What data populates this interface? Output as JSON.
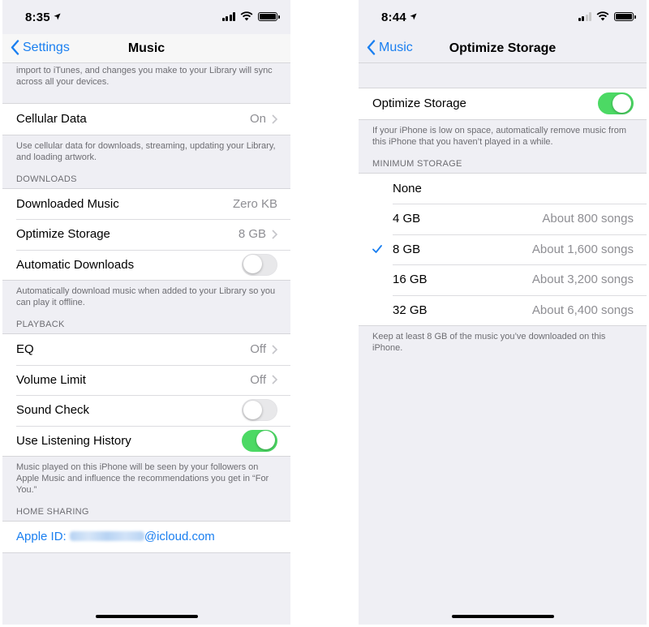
{
  "left": {
    "status": {
      "time": "8:35"
    },
    "nav": {
      "back_label": "Settings",
      "title": "Music"
    },
    "top_footer": "import to iTunes, and changes you make to your Library will sync across all your devices.",
    "cellular": {
      "label": "Cellular Data",
      "value": "On",
      "footer": "Use cellular data for downloads, streaming, updating your Library, and loading artwork."
    },
    "downloads": {
      "header": "DOWNLOADS",
      "downloaded_music": {
        "label": "Downloaded Music",
        "value": "Zero KB"
      },
      "optimize_storage": {
        "label": "Optimize Storage",
        "value": "8 GB"
      },
      "automatic_downloads": {
        "label": "Automatic Downloads",
        "on": false
      },
      "footer": "Automatically download music when added to your Library so you can play it offline."
    },
    "playback": {
      "header": "PLAYBACK",
      "eq": {
        "label": "EQ",
        "value": "Off"
      },
      "volume_limit": {
        "label": "Volume Limit",
        "value": "Off"
      },
      "sound_check": {
        "label": "Sound Check",
        "on": false
      },
      "listening_history": {
        "label": "Use Listening History",
        "on": true
      },
      "footer": "Music played on this iPhone will be seen by your followers on Apple Music and influence the recommendations you get in “For You.”"
    },
    "home_sharing": {
      "header": "HOME SHARING",
      "apple_id_prefix": "Apple ID: ",
      "apple_id_domain": "@icloud.com"
    }
  },
  "right": {
    "status": {
      "time": "8:44"
    },
    "nav": {
      "back_label": "Music",
      "title": "Optimize Storage"
    },
    "optimize": {
      "label": "Optimize Storage",
      "on": true,
      "footer": "If your iPhone is low on space, automatically remove music from this iPhone that you haven’t played in a while."
    },
    "minimum_storage": {
      "header": "MINIMUM STORAGE",
      "options": [
        {
          "label": "None",
          "detail": "",
          "selected": false
        },
        {
          "label": "4 GB",
          "detail": "About 800 songs",
          "selected": false
        },
        {
          "label": "8 GB",
          "detail": "About 1,600 songs",
          "selected": true
        },
        {
          "label": "16 GB",
          "detail": "About 3,200 songs",
          "selected": false
        },
        {
          "label": "32 GB",
          "detail": "About 6,400 songs",
          "selected": false
        }
      ],
      "footer": "Keep at least 8 GB of the music you’ve downloaded on this iPhone."
    }
  },
  "colors": {
    "accent": "#1a7ff0",
    "toggle_on": "#4cd964",
    "background": "#efeff4",
    "secondary_text": "#8e8e93"
  },
  "icons": {
    "back": "chevron-left-icon",
    "disclosure": "chevron-right-icon",
    "location": "location-arrow-icon",
    "check": "checkmark-icon"
  }
}
